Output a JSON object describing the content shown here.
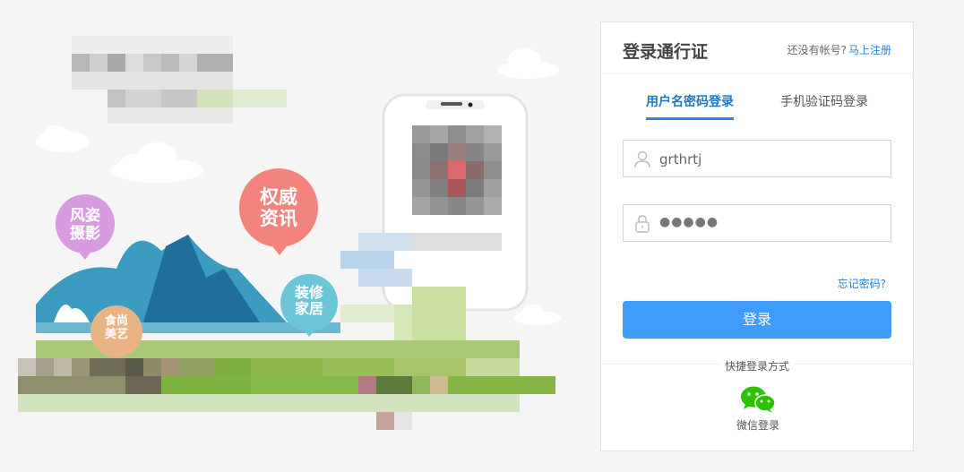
{
  "illustration": {
    "bubbles": [
      {
        "text": "风姿\n摄影",
        "color": "#d99be0"
      },
      {
        "text": "权威\n资讯",
        "color": "#f2837d"
      },
      {
        "text": "装修\n家居",
        "color": "#6cc6d8"
      },
      {
        "text": "食尚\n美艺",
        "color": "#e9b484"
      }
    ]
  },
  "login": {
    "title": "登录通行证",
    "register_prompt": "还没有帐号?",
    "register_link": "马上注册",
    "tabs": [
      {
        "label": "用户名密码登录",
        "active": true
      },
      {
        "label": "手机验证码登录",
        "active": false
      }
    ],
    "username_value": "grthrtj",
    "password_mask": "●●●●●",
    "forgot_label": "忘记密码?",
    "submit_label": "登录",
    "quick_login_label": "快捷登录方式",
    "wechat_label": "微信登录"
  },
  "colors": {
    "accent": "#3f9cfa",
    "link": "#2a7fd4",
    "wechat": "#2dc100"
  }
}
